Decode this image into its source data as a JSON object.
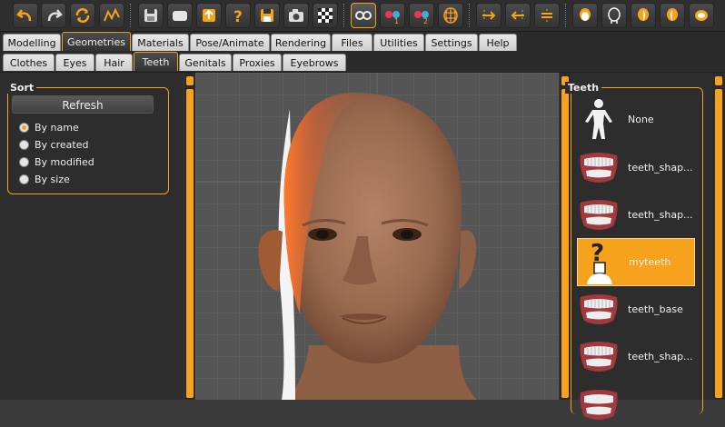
{
  "toolbar": {
    "icons": [
      "undo-icon",
      "redo-icon",
      "reset-icon",
      "smooth-icon",
      "save-icon",
      "load-icon",
      "export-icon",
      "help-icon",
      "save-target-icon",
      "screenshot-icon",
      "checker-icon",
      "wireframe-glasses-icon",
      "stereo-1-icon",
      "stereo-2-icon",
      "grid-sphere-icon",
      "front-view-icon",
      "back-view-icon",
      "top-view-icon",
      "face-front-icon",
      "face-back-icon",
      "face-left-icon",
      "face-right-icon",
      "face-top-icon"
    ]
  },
  "main_tabs": [
    {
      "label": "Modelling",
      "selected": false
    },
    {
      "label": "Geometries",
      "selected": true
    },
    {
      "label": "Materials",
      "selected": false
    },
    {
      "label": "Pose/Animate",
      "selected": false
    },
    {
      "label": "Rendering",
      "selected": false
    },
    {
      "label": "Files",
      "selected": false
    },
    {
      "label": "Utilities",
      "selected": false
    },
    {
      "label": "Settings",
      "selected": false
    },
    {
      "label": "Help",
      "selected": false
    }
  ],
  "sub_tabs": [
    {
      "label": "Clothes",
      "selected": false
    },
    {
      "label": "Eyes",
      "selected": false
    },
    {
      "label": "Hair",
      "selected": false
    },
    {
      "label": "Teeth",
      "selected": true
    },
    {
      "label": "Genitals",
      "selected": false
    },
    {
      "label": "Proxies",
      "selected": false
    },
    {
      "label": "Eyebrows",
      "selected": false
    }
  ],
  "sort": {
    "title": "Sort",
    "refresh_label": "Refresh",
    "options": [
      {
        "label": "By name",
        "checked": true
      },
      {
        "label": "By created",
        "checked": false
      },
      {
        "label": "By modified",
        "checked": false
      },
      {
        "label": "By size",
        "checked": false
      }
    ]
  },
  "teeth": {
    "title": "Teeth",
    "items": [
      {
        "label": "None",
        "thumb": "figure-icon",
        "selected": false
      },
      {
        "label": "teeth_shap...",
        "thumb": "teeth-icon",
        "selected": false
      },
      {
        "label": "teeth_shap...",
        "thumb": "teeth-icon",
        "selected": false
      },
      {
        "label": "myteeth",
        "thumb": "unknown-figure-icon",
        "selected": true
      },
      {
        "label": "teeth_base",
        "thumb": "teeth-icon",
        "selected": false
      },
      {
        "label": "teeth_shap...",
        "thumb": "teeth-icon",
        "selected": false
      },
      {
        "label": "",
        "thumb": "teeth-icon",
        "selected": false
      }
    ]
  },
  "colors": {
    "accent": "#f6a21d",
    "panel": "#2d2d2d",
    "viewport": "#555555",
    "skin": "#a47458"
  }
}
